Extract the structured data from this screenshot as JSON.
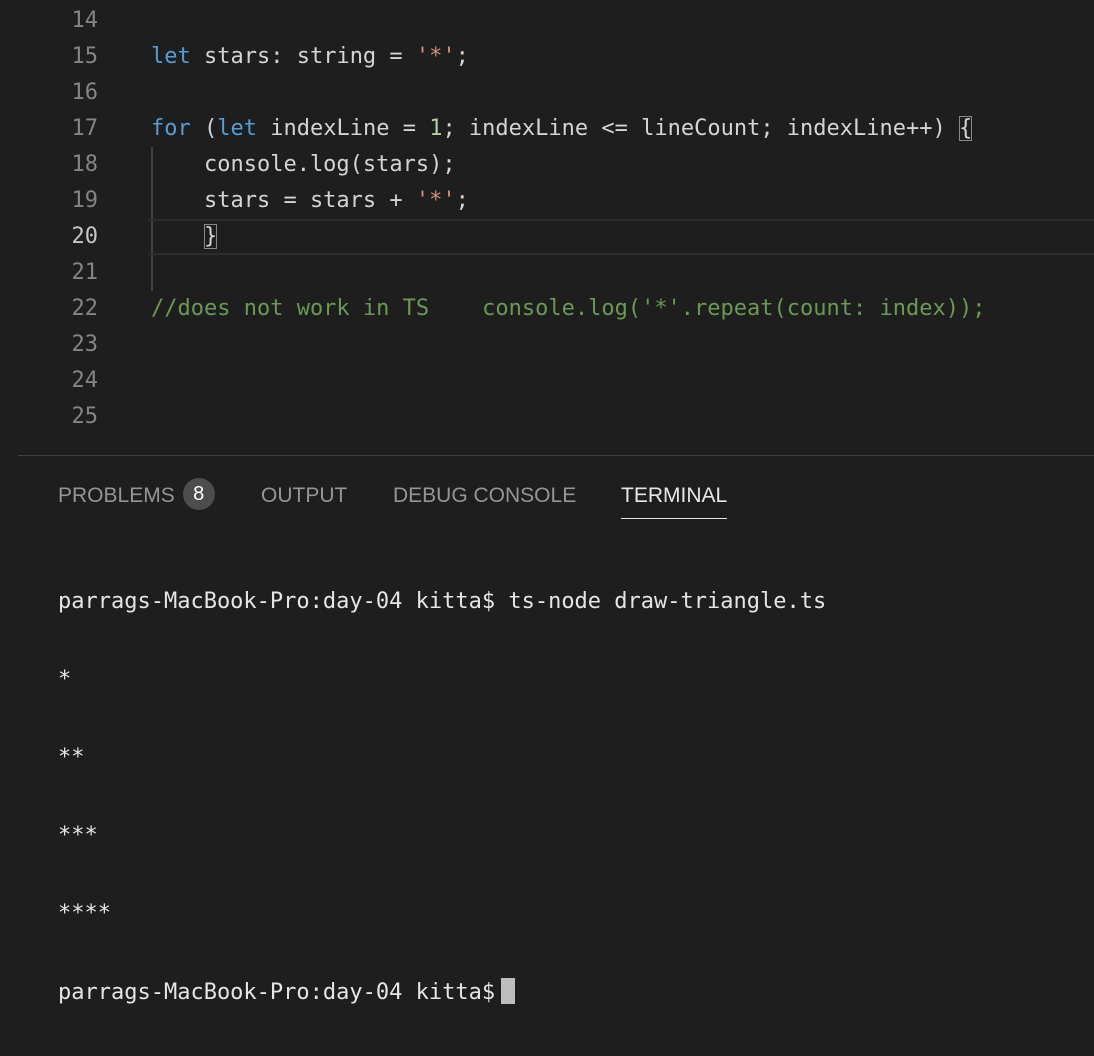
{
  "editor": {
    "lines": [
      {
        "num": "14"
      },
      {
        "num": "15",
        "t1": "let",
        "t2": " stars: string = ",
        "t3": "'*'",
        "t4": ";"
      },
      {
        "num": "16"
      },
      {
        "num": "17",
        "t1": "for",
        "t2": " (",
        "t3": "let",
        "t4": " indexLine = ",
        "t5": "1",
        "t6": "; indexLine <= lineCount; indexLine++) ",
        "t7": "{"
      },
      {
        "num": "18",
        "t1": "    console.log(stars);"
      },
      {
        "num": "19",
        "t1": "    stars = stars + ",
        "t2": "'*'",
        "t3": ";"
      },
      {
        "num": "20",
        "t1": "    ",
        "t2": "}"
      },
      {
        "num": "21"
      },
      {
        "num": "22",
        "t1": "//does not work in TS    console.log('*'.repeat(count: index));"
      },
      {
        "num": "23"
      },
      {
        "num": "24"
      },
      {
        "num": "25"
      }
    ],
    "current_line": "20"
  },
  "panel": {
    "tabs": [
      {
        "label": "PROBLEMS",
        "badge": "8"
      },
      {
        "label": "OUTPUT"
      },
      {
        "label": "DEBUG CONSOLE"
      },
      {
        "label": "TERMINAL",
        "active": true
      }
    ],
    "terminal": {
      "lines": [
        "parrags-MacBook-Pro:day-04 kitta$ ts-node draw-triangle.ts",
        "*",
        "**",
        "***",
        "****"
      ],
      "prompt": "parrags-MacBook-Pro:day-04 kitta$"
    }
  },
  "colors": {
    "background": "#1e1e1e",
    "keyword": "#569cd6",
    "string": "#ce9178",
    "number": "#b5cea8",
    "comment": "#6a9955",
    "line_number": "#858585"
  }
}
